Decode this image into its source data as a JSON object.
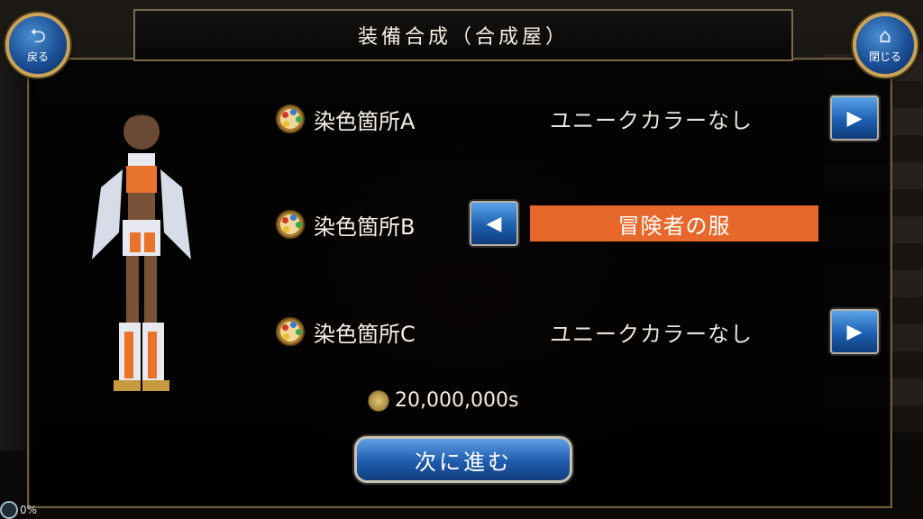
{
  "header": {
    "title": "装備合成（合成屋）",
    "back_label": "戻る",
    "close_label": "閉じる"
  },
  "rows": [
    {
      "label": "染色箇所A",
      "value": "ユニークカラーなし",
      "arrow": "▶"
    },
    {
      "label": "染色箇所B",
      "value": "冒険者の服",
      "arrow": "◀"
    },
    {
      "label": "染色箇所C",
      "value": "ユニークカラーなし",
      "arrow": "▶"
    }
  ],
  "price": "20,000,000s",
  "next_button": "次に進む",
  "status": {
    "percent": "0%"
  },
  "colors": {
    "accent": "#e8672a",
    "button_blue": "#1f5cae",
    "frame_gold": "#c9a357"
  },
  "icons": {
    "back": "back-arrow-icon",
    "close": "house-icon",
    "palette": "palette-icon",
    "coin": "coin-icon"
  }
}
